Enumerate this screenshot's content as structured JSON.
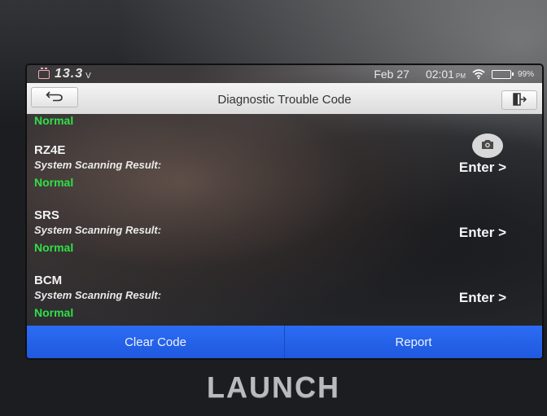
{
  "status_bar": {
    "voltage": "13.3",
    "voltage_unit": "V",
    "date": "Feb 27",
    "time": "02:01",
    "ampm": "PM",
    "battery_percent": "99%",
    "battery_level": 0.99,
    "battery_color": "#25d93c"
  },
  "header": {
    "title": "Diagnostic Trouble Code",
    "back_icon": "back-arrow-icon",
    "exit_icon": "exit-door-icon"
  },
  "list": {
    "partial_top_result": "Normal",
    "items": [
      {
        "name": "RZ4E",
        "label": "System Scanning Result:",
        "result": "Normal",
        "action": "Enter >"
      },
      {
        "name": "SRS",
        "label": "System Scanning Result:",
        "result": "Normal",
        "action": "Enter >"
      },
      {
        "name": "BCM",
        "label": "System Scanning Result:",
        "result": "Normal",
        "action": "Enter >"
      }
    ],
    "camera_icon": "camera-icon"
  },
  "footer": {
    "clear_label": "Clear Code",
    "report_label": "Report",
    "button_color": "#2c6cf4"
  },
  "device": {
    "brand": "LAUNCH"
  }
}
